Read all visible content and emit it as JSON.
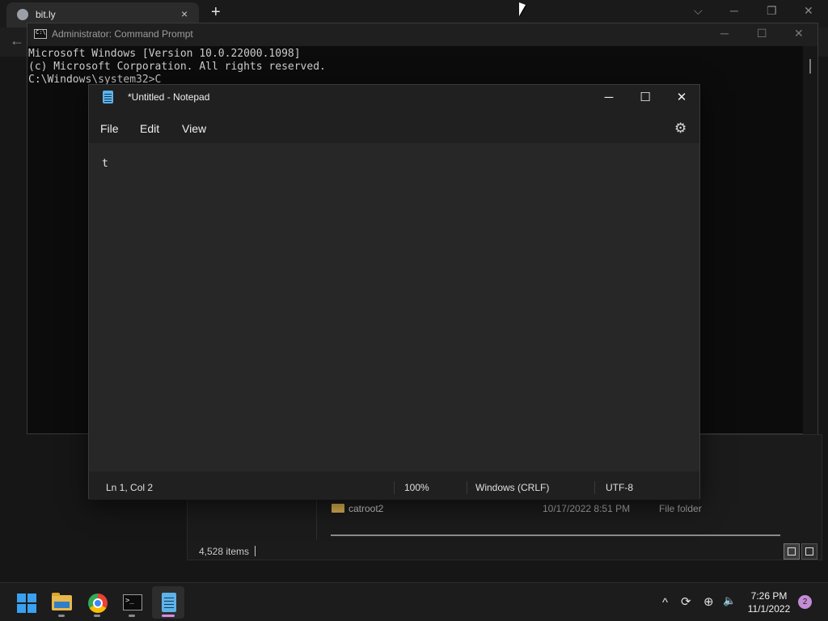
{
  "browser": {
    "tab_title": "bit.ly",
    "tab_close": "×",
    "new_tab": "+",
    "tab_search": "⌵",
    "minimize": "─",
    "restore": "❐",
    "close": "✕",
    "back": "←"
  },
  "cmd": {
    "title": "Administrator: Command Prompt",
    "minimize": "─",
    "maximize": "☐",
    "close": "✕",
    "lines": [
      "Microsoft Windows [Version 10.0.22000.1098]",
      "(c) Microsoft Corporation. All rights reserved.",
      "C:\\Windows\\system32>C"
    ]
  },
  "notepad": {
    "title": "*Untitled - Notepad",
    "minimize": "─",
    "maximize": "☐",
    "close": "✕",
    "menus": [
      "File",
      "Edit",
      "View"
    ],
    "settings_icon": "⚙",
    "content": "t",
    "status": {
      "position": "Ln 1, Col 2",
      "zoom": "100%",
      "line_ending": "Windows (CRLF)",
      "encoding": "UTF-8"
    }
  },
  "explorer": {
    "rows": [
      {
        "name": "catroot2",
        "modified": "10/17/2022 8:51 PM",
        "type": "File folder"
      }
    ],
    "item_count": "4,528 items"
  },
  "taskbar": {
    "apps": [
      {
        "name": "Start",
        "icon": "windows-logo-icon"
      },
      {
        "name": "File Explorer",
        "icon": "folder-icon"
      },
      {
        "name": "Google Chrome",
        "icon": "chrome-icon"
      },
      {
        "name": "Command Prompt",
        "icon": "terminal-icon"
      },
      {
        "name": "Notepad",
        "icon": "notepad-icon"
      }
    ],
    "tray": {
      "chevron": "^",
      "sync": "⟳",
      "network": "⊕",
      "volume": "🔈"
    },
    "time": "7:26 PM",
    "date": "11/1/2022",
    "notification_count": "2"
  },
  "colors": {
    "accent": "#d78ae8",
    "windows_blue": "#3aa0f0",
    "notepad_blue": "#5fb2e8",
    "folder_yellow": "#d8b050"
  }
}
